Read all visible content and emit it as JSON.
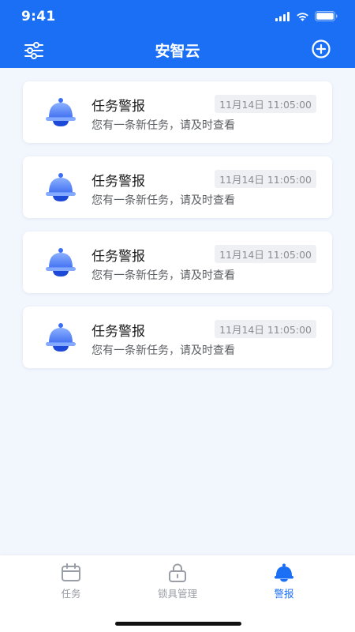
{
  "status": {
    "time": "9:41"
  },
  "header": {
    "title": "安智云"
  },
  "notifications": [
    {
      "title": "任务警报",
      "time": "11月14日 11:05:00",
      "desc": "您有一条新任务，请及时查看"
    },
    {
      "title": "任务警报",
      "time": "11月14日 11:05:00",
      "desc": "您有一条新任务，请及时查看"
    },
    {
      "title": "任务警报",
      "time": "11月14日 11:05:00",
      "desc": "您有一条新任务，请及时查看"
    },
    {
      "title": "任务警报",
      "time": "11月14日 11:05:00",
      "desc": "您有一条新任务，请及时查看"
    }
  ],
  "tabbar": {
    "items": [
      {
        "label": "任务",
        "icon": "calendar-icon",
        "active": false
      },
      {
        "label": "锁具管理",
        "icon": "lock-icon",
        "active": false
      },
      {
        "label": "警报",
        "icon": "bell-icon",
        "active": true
      }
    ]
  },
  "colors": {
    "primary": "#1a6ff5",
    "background": "#f2f6fd",
    "inactive": "#9a9ea6"
  }
}
